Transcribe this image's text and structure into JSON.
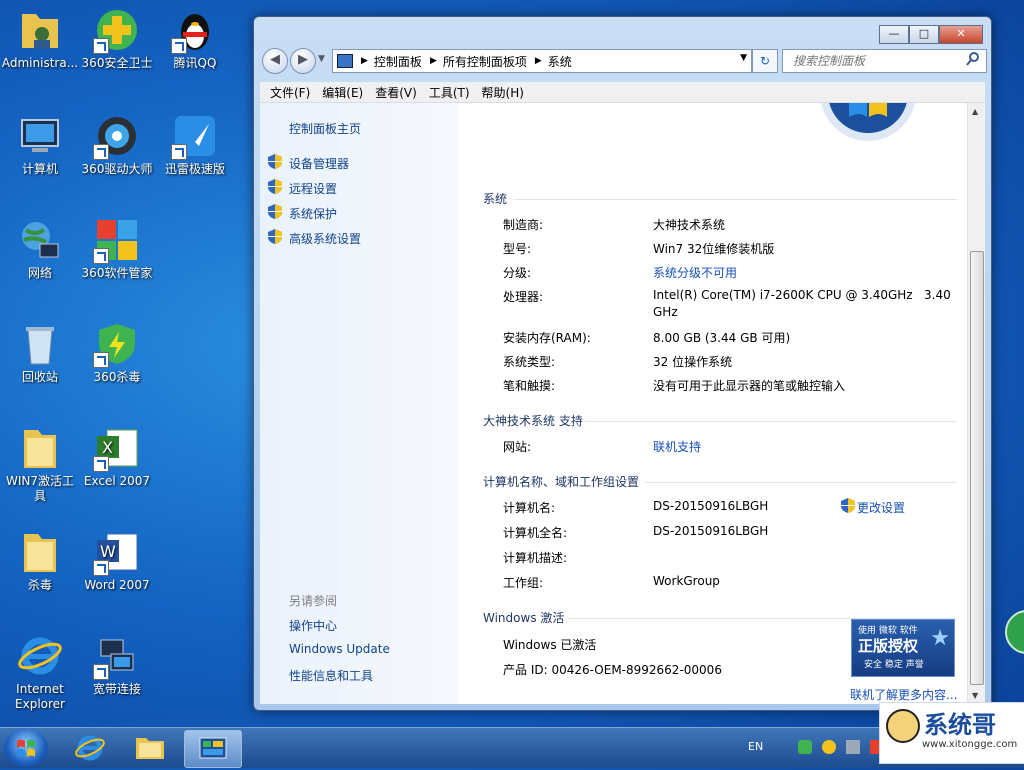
{
  "desktop": {
    "icons": [
      {
        "label": "Administra..."
      },
      {
        "label": "360安全卫士"
      },
      {
        "label": "腾讯QQ"
      },
      {
        "label": "计算机"
      },
      {
        "label": "360驱动大师"
      },
      {
        "label": "迅雷极速版"
      },
      {
        "label": "网络"
      },
      {
        "label": "360软件管家"
      },
      {
        "label": "回收站"
      },
      {
        "label": "360杀毒"
      },
      {
        "label": "WIN7激活工具"
      },
      {
        "label": "Excel 2007"
      },
      {
        "label": "杀毒"
      },
      {
        "label": "Word 2007"
      },
      {
        "label": "Internet Explorer"
      },
      {
        "label": "宽带连接"
      }
    ]
  },
  "window": {
    "breadcrumb": [
      "控制面板",
      "所有控制面板项",
      "系统"
    ],
    "search_placeholder": "搜索控制面板",
    "menu": [
      "文件(F)",
      "编辑(E)",
      "查看(V)",
      "工具(T)",
      "帮助(H)"
    ],
    "left": {
      "home": "控制面板主页",
      "tasks": [
        "设备管理器",
        "远程设置",
        "系统保护",
        "高级系统设置"
      ],
      "see_also_title": "另请参阅",
      "see_also": [
        "操作中心",
        "Windows Update",
        "性能信息和工具"
      ]
    },
    "system": {
      "title": "系统",
      "rows": [
        {
          "label": "制造商:",
          "value": "大神技术系统"
        },
        {
          "label": "型号:",
          "value": "Win7 32位维修装机版"
        },
        {
          "label": "分级:",
          "value": "系统分级不可用"
        },
        {
          "label": "处理器:",
          "value": "Intel(R) Core(TM) i7-2600K CPU @ 3.40GHz   3.40",
          "value2": "GHz"
        },
        {
          "label": "安装内存(RAM):",
          "value": "8.00 GB (3.44 GB 可用)"
        },
        {
          "label": "系统类型:",
          "value": "32 位操作系统"
        },
        {
          "label": "笔和触摸:",
          "value": "没有可用于此显示器的笔或触控输入"
        }
      ]
    },
    "support": {
      "title": "大神技术系统 支持",
      "website_label": "网站:",
      "website_value": "联机支持"
    },
    "computer": {
      "title": "计算机名称、域和工作组设置",
      "change": "更改设置",
      "rows": [
        {
          "label": "计算机名:",
          "value": "DS-20150916LBGH"
        },
        {
          "label": "计算机全名:",
          "value": "DS-20150916LBGH"
        },
        {
          "label": "计算机描述:",
          "value": ""
        },
        {
          "label": "工作组:",
          "value": "WorkGroup"
        }
      ]
    },
    "activation": {
      "title": "Windows 激活",
      "status": "Windows 已激活",
      "product_id": "产品 ID: 00426-OEM-8992662-00006",
      "badge_top": "使用 微软 软件",
      "badge_main": "正版授权",
      "badge_sub": "安全 稳定 声誉",
      "learn_more": "联机了解更多内容..."
    }
  },
  "taskbar": {
    "lang": "EN",
    "watermark_text": "系统哥",
    "watermark_url": "www.xitongge.com"
  },
  "colors": {
    "link": "#1750b7",
    "heading": "#1e3764",
    "taskbar": "#2a5b9d"
  }
}
